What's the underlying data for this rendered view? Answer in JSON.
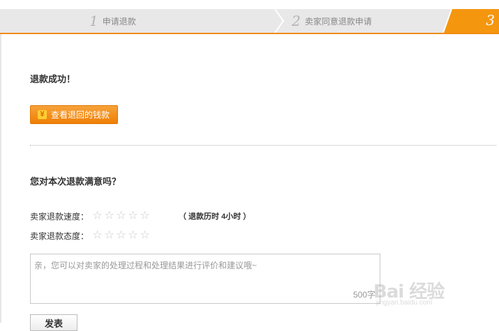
{
  "steps": [
    {
      "num": "1",
      "label": "申请退款"
    },
    {
      "num": "2",
      "label": "卖家同意退款申请"
    },
    {
      "num": "3",
      "label": ""
    }
  ],
  "success": {
    "title": "退款成功！"
  },
  "money_button": {
    "label": "查看退回的钱款",
    "icon": "yuan-icon",
    "icon_glyph": "¥"
  },
  "feedback": {
    "question": "您对本次退款满意吗？",
    "speed": {
      "label": "卖家退款速度：",
      "rating": 0,
      "max": 5
    },
    "attitude": {
      "label": "卖家退款态度：",
      "rating": 0,
      "max": 5
    },
    "duration": {
      "prefix": "（ 退款历时 ",
      "value": "4小时",
      "suffix": " ）"
    }
  },
  "comment": {
    "placeholder": "亲，您可以对卖家的处理过程和处理结果进行评价和建议哦~",
    "counter": "500字"
  },
  "submit": {
    "label": "发表"
  },
  "watermark": {
    "brand": "Bai 经验",
    "url": "jingyan.baidu.com"
  },
  "colors": {
    "accent": "#f08b0e",
    "step_bg": "#e8e8e8"
  }
}
